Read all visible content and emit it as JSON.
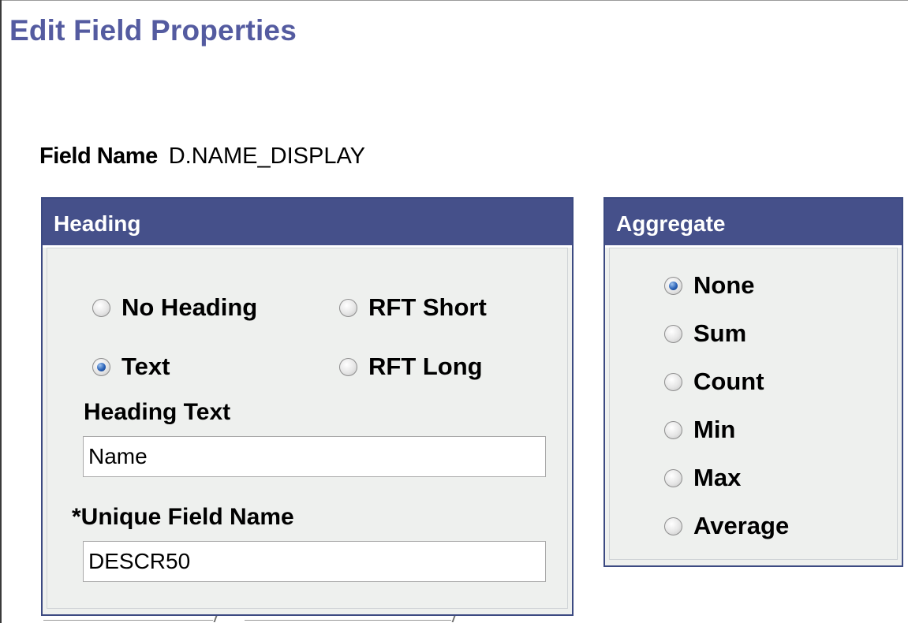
{
  "page": {
    "title": "Edit Field Properties"
  },
  "field": {
    "name_label": "Field Name",
    "name_value": "D.NAME_DISPLAY"
  },
  "heading": {
    "title": "Heading",
    "options": {
      "no_heading": "No Heading",
      "rft_short": "RFT Short",
      "text": "Text",
      "rft_long": "RFT Long"
    },
    "selected": "Text",
    "heading_text_label": "Heading Text",
    "heading_text_value": "Name",
    "unique_field_label": "*Unique Field Name",
    "unique_field_value": "DESCR50"
  },
  "aggregate": {
    "title": "Aggregate",
    "options": {
      "none": "None",
      "sum": "Sum",
      "count": "Count",
      "min": "Min",
      "max": "Max",
      "average": "Average"
    },
    "selected": "None"
  },
  "colors": {
    "title": "#545ba0",
    "header_bg": "#45508a",
    "panel_bg": "#eef0ee",
    "radio_selected": "#2a62b8"
  }
}
